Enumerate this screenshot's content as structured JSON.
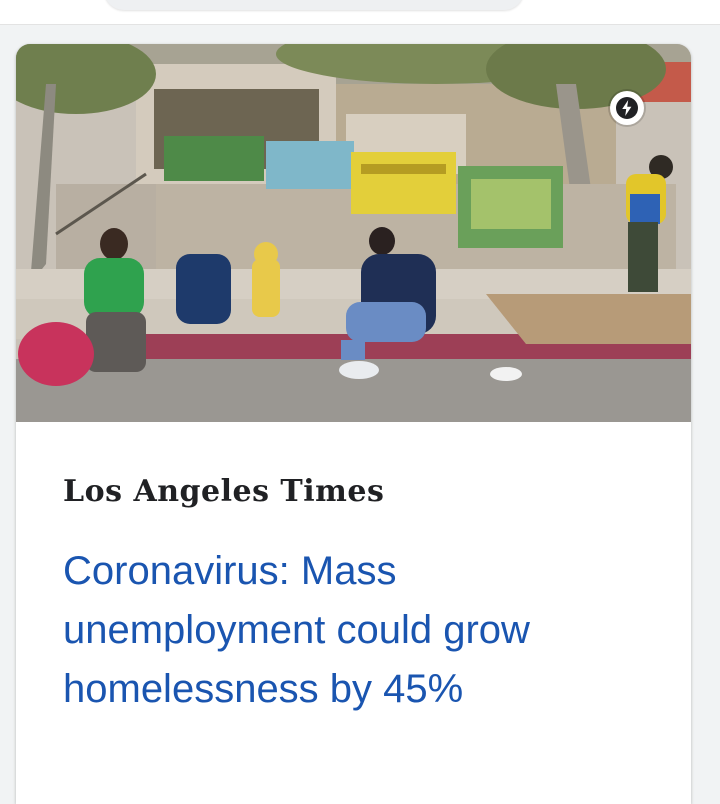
{
  "colors": {
    "headline": "#1a55b0",
    "publisher": "#202124",
    "page_background": "#f1f3f4",
    "card_background": "#ffffff"
  },
  "search_bar": {
    "icon": "search-bar-partially-visible"
  },
  "article": {
    "image_icon": "amp-lightning-icon",
    "image_subject": "photo",
    "publisher": "Los Angeles Times",
    "headline": "Coronavirus: Mass unemployment could grow homelessness by 45%"
  }
}
